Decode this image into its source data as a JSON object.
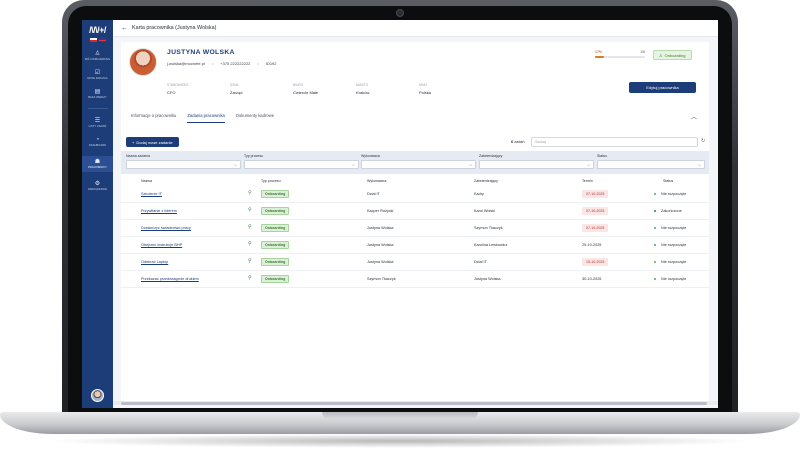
{
  "app": {
    "logo": "/\\/\\/+/"
  },
  "sidebar": {
    "items": [
      {
        "label": "Mój onboarding",
        "icon": "person-icon",
        "glyph": "♙"
      },
      {
        "label": "Moje zadania",
        "icon": "checklist-icon",
        "glyph": "☑"
      },
      {
        "label": "Baza wiedzy",
        "icon": "book-icon",
        "glyph": "▤"
      },
      {
        "label": "Listy zadań",
        "icon": "list-icon",
        "glyph": "☰"
      },
      {
        "label": "Dashboard",
        "icon": "dashboard-icon",
        "glyph": "◔"
      },
      {
        "label": "Pracownicy",
        "icon": "people-icon",
        "glyph": "☗",
        "active": true
      },
      {
        "label": "Zarządzanie",
        "icon": "settings-icon",
        "glyph": "⚙"
      }
    ]
  },
  "header": {
    "breadcrumb": "Karta pracownika (Justyna Wolska)"
  },
  "profile": {
    "name": "JUSTYNA WOLSKA",
    "email": "j.wolska@mocnefe.pl",
    "phone": "+375 222222222",
    "id": "ID192",
    "progress": {
      "left_label": "17%",
      "right_label": "1/6",
      "fraction": 0.17
    },
    "status": "Onboarding",
    "details": [
      {
        "label": "Stanowisko",
        "value": "CFO"
      },
      {
        "label": "Dział",
        "value": "Zarząd"
      },
      {
        "label": "Biuro",
        "value": "Ćwiercie Małe"
      },
      {
        "label": "Miasto",
        "value": "Kraków"
      },
      {
        "label": "Kraj",
        "value": "Polska"
      }
    ],
    "edit_button": "Edytuj pracownika"
  },
  "tabs": [
    {
      "label": "Informacje o pracowniku",
      "active": false
    },
    {
      "label": "Zadania pracownika",
      "active": true
    },
    {
      "label": "Dokumenty kadrowe",
      "active": false
    }
  ],
  "tasks": {
    "add_button": "Dodaj nowe zadanie",
    "count_number": "6",
    "count_label": "zadań",
    "search_placeholder": "Szukaj",
    "filters": [
      {
        "label": "Nazwa zadania"
      },
      {
        "label": "Typ procesu"
      },
      {
        "label": "Wykonawca"
      },
      {
        "label": "Zatwierdzający"
      },
      {
        "label": "Status"
      }
    ],
    "columns": [
      "Nazwa",
      "Typ procesu",
      "Wykonawca",
      "Zatwierdzający",
      "Termin",
      "Status"
    ],
    "rows": [
      {
        "name": "Szkolenie IT",
        "process": "Onboarding",
        "assignee": "Dział IT",
        "approver": "Kadry",
        "due": "07-10-2025",
        "due_overdue": true,
        "status": "Nie rozpoczęte",
        "status_color": "#4caf50"
      },
      {
        "name": "Przywitanie z liderem",
        "process": "Onboarding",
        "assignee": "Kacper Różycki",
        "approver": "Karol Wolski",
        "due": "07-10-2025",
        "due_overdue": true,
        "status": "Zakończone",
        "status_color": "#2e7d32"
      },
      {
        "name": "Dostarczyć świadectwo pracy",
        "process": "Onboarding",
        "assignee": "Justyna Wolska",
        "approver": "Szymon Tkaczyk",
        "due": "07-10-2025",
        "due_overdue": true,
        "status": "Nie rozpoczęte",
        "status_color": "#4caf50"
      },
      {
        "name": "Obejrzeć instrukcje BHP",
        "process": "Onboarding",
        "assignee": "Justyna Wolska",
        "approver": "Karolina Lewkowicz",
        "due": "29-10-2025",
        "due_overdue": false,
        "status": "Nie rozpoczęte",
        "status_color": "#4caf50"
      },
      {
        "name": "Odebrać Laptop",
        "process": "Onboarding",
        "assignee": "Justyna Wolska",
        "approver": "Dział IT",
        "due": "15-10-2025",
        "due_overdue": true,
        "status": "Nie rozpoczęte",
        "status_color": "#4caf50"
      },
      {
        "name": "Przekazać przedwstępnie drukiem",
        "process": "Onboarding",
        "assignee": "Szymon Tkaczyk",
        "approver": "Justyna Wolska",
        "due": "30-10-2025",
        "due_overdue": false,
        "status": "Nie rozpoczęte",
        "status_color": "#4caf50"
      }
    ]
  }
}
